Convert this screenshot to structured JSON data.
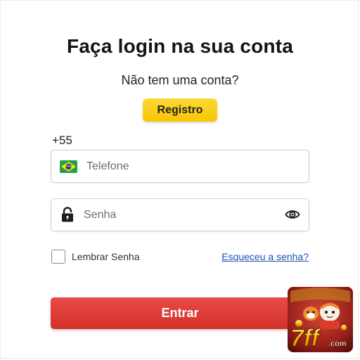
{
  "login": {
    "title": "Faça login na sua conta",
    "subtitle": "Não tem uma conta?",
    "register_label": "Registro",
    "country_code": "+55",
    "phone_placeholder": "Telefone",
    "password_placeholder": "Senha",
    "remember_label": "Lembrar Senha",
    "remember_checked": false,
    "forgot_label": "Esqueceu a senha?",
    "submit_label": "Entrar"
  },
  "icons": {
    "flag": "brazil-flag-icon",
    "lock": "lock-icon",
    "eye": "eye-icon"
  },
  "logo": {
    "text": "7ff.com"
  },
  "colors": {
    "register_button": "#f9cf14",
    "submit_button": "#dc3a35",
    "link": "#1a55b3",
    "title": "#141414"
  }
}
